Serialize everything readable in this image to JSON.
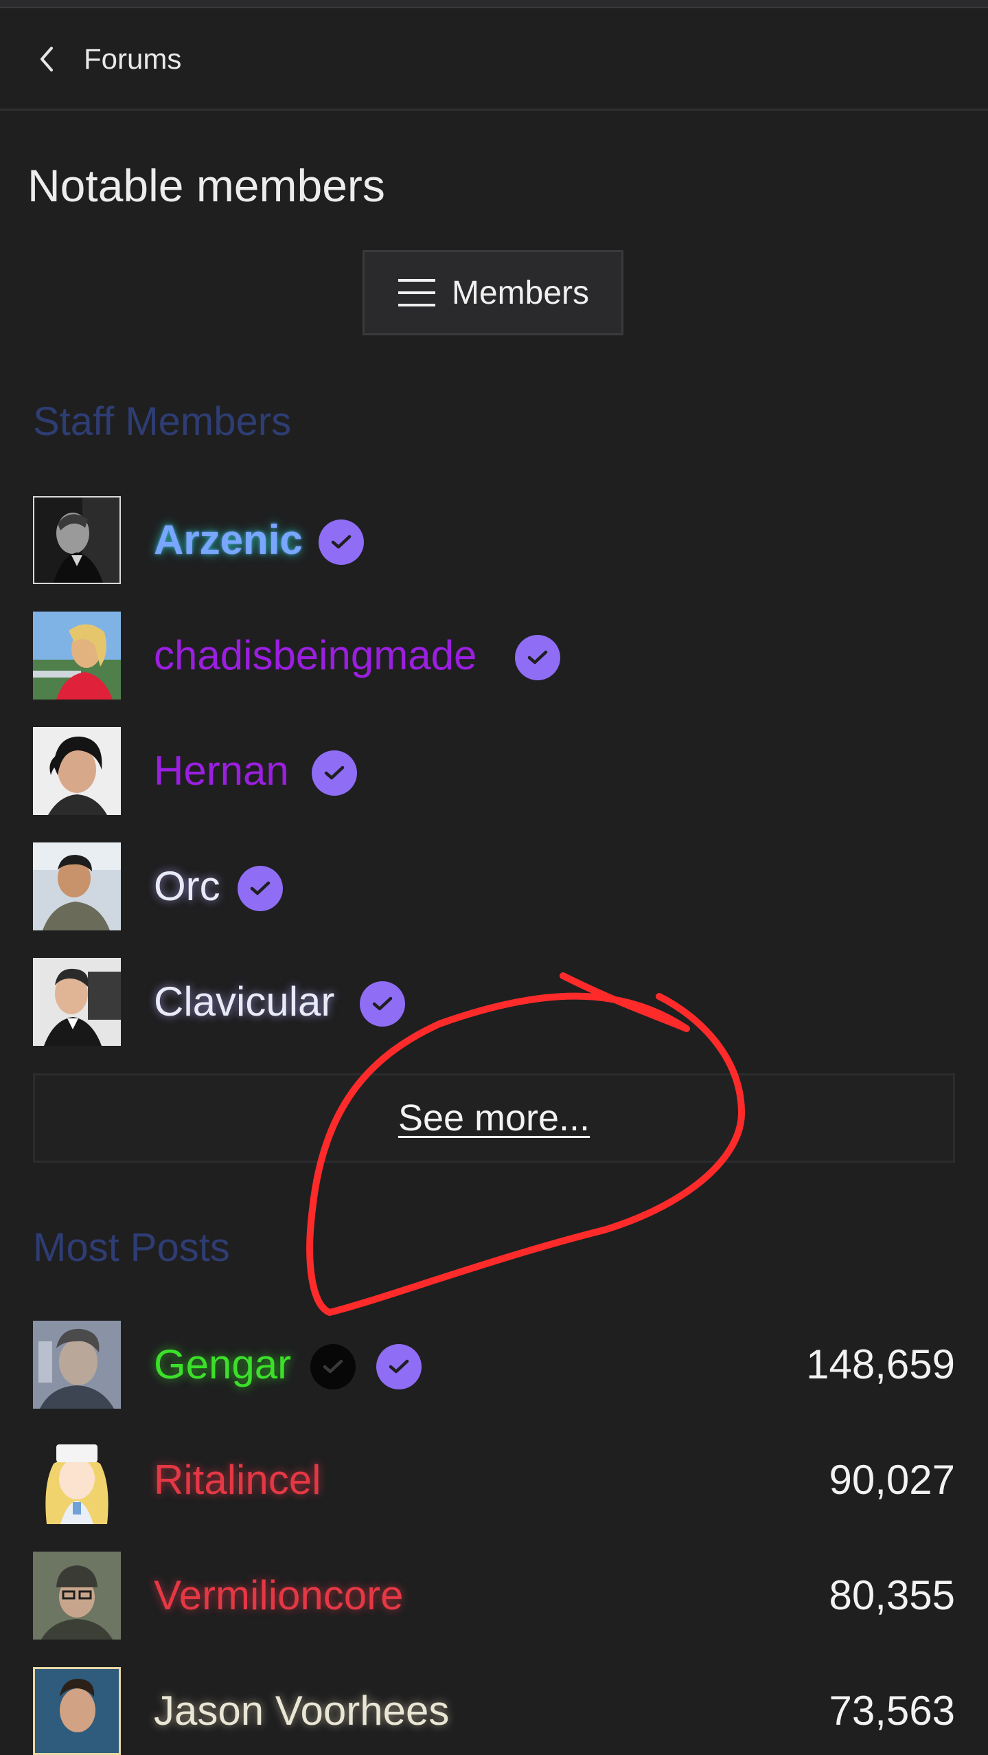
{
  "nav": {
    "back_label": "Forums"
  },
  "page": {
    "title": "Notable members"
  },
  "members_menu": {
    "label": "Members"
  },
  "sections": {
    "staff": {
      "heading": "Staff Members",
      "members": [
        {
          "name": "Arzenic",
          "color": "#7aa6ff",
          "badges": [
            "verified"
          ]
        },
        {
          "name": "chadisbeingmade",
          "color": "#9b1fe0",
          "badges": [
            "verified"
          ]
        },
        {
          "name": "Hernan",
          "color": "#9b1fe0",
          "badges": [
            "verified"
          ]
        },
        {
          "name": "Orc",
          "color": "#e8eaf6",
          "badges": [
            "verified"
          ]
        },
        {
          "name": "Clavicular",
          "color": "#e8eaf6",
          "badges": [
            "verified"
          ]
        }
      ],
      "see_more": "See more..."
    },
    "most_posts": {
      "heading": "Most Posts",
      "members": [
        {
          "name": "Gengar",
          "color": "#3ce02a",
          "count": "148,659",
          "badges": [
            "black-check",
            "verified"
          ]
        },
        {
          "name": "Ritalincel",
          "color": "#e43845",
          "count": "90,027",
          "badges": []
        },
        {
          "name": "Vermilioncore",
          "color": "#e43845",
          "count": "80,355",
          "badges": []
        },
        {
          "name": "Jason Voorhees",
          "color": "#e9e6d6",
          "count": "73,563",
          "badges": []
        }
      ]
    }
  },
  "colors": {
    "background": "#1f1f20",
    "section_heading": "#2e3d73",
    "verified_badge": "#8f6df5",
    "annotation": "#ff2b2b"
  },
  "icons": {
    "back": "chevron-left-icon",
    "menu": "hamburger-icon",
    "verified": "verified-check-icon"
  }
}
